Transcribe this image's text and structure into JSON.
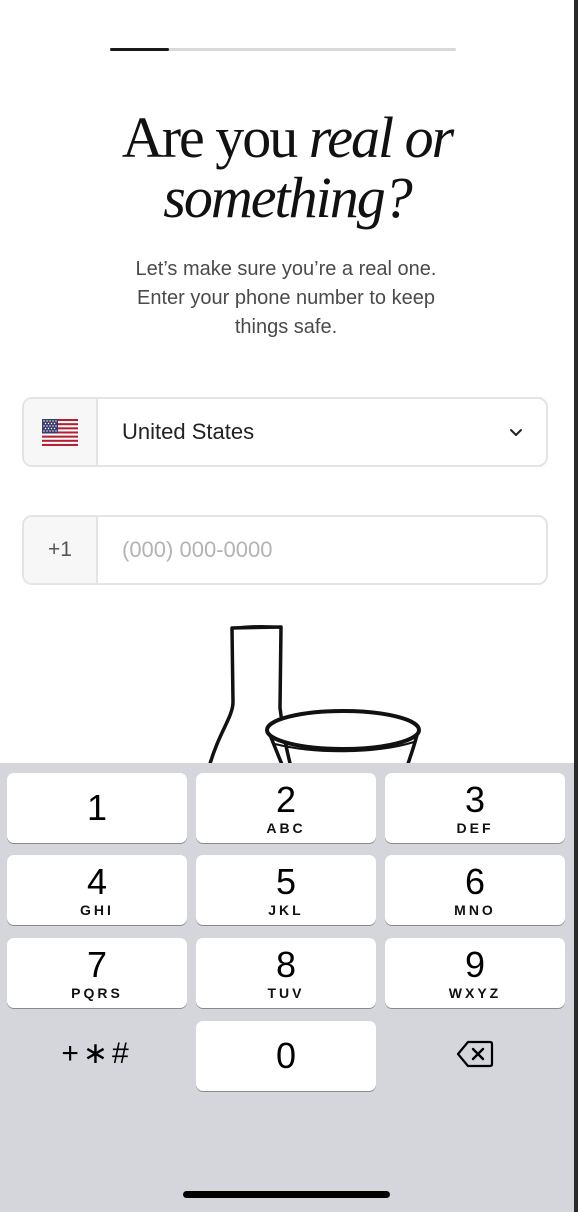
{
  "progress": {
    "fraction": 0.17
  },
  "heading": {
    "line1_plain": "Are you ",
    "line1_italic": "real or",
    "line2_italic": "something?"
  },
  "subtitle": "Let’s make sure you’re a real one. Enter your phone number to keep things safe.",
  "country_field": {
    "flag_icon": "us-flag-icon",
    "value": "United States",
    "chevron_icon": "chevron-down-icon"
  },
  "phone_field": {
    "prefix": "+1",
    "value": "",
    "placeholder": "(000) 000-0000"
  },
  "illustration": "bottle-and-bowl-drawing",
  "keypad": {
    "keys": [
      {
        "num": "1",
        "letters": ""
      },
      {
        "num": "2",
        "letters": "ABC"
      },
      {
        "num": "3",
        "letters": "DEF"
      },
      {
        "num": "4",
        "letters": "GHI"
      },
      {
        "num": "5",
        "letters": "JKL"
      },
      {
        "num": "6",
        "letters": "MNO"
      },
      {
        "num": "7",
        "letters": "PQRS"
      },
      {
        "num": "8",
        "letters": "TUV"
      },
      {
        "num": "9",
        "letters": "WXYZ"
      },
      {
        "num": "+∗#",
        "letters": ""
      },
      {
        "num": "0",
        "letters": ""
      },
      {
        "num": "",
        "letters": "",
        "icon": "backspace-icon"
      }
    ]
  },
  "colors": {
    "accent": "#1a1a1a",
    "keypad_bg": "#d4d6db"
  }
}
